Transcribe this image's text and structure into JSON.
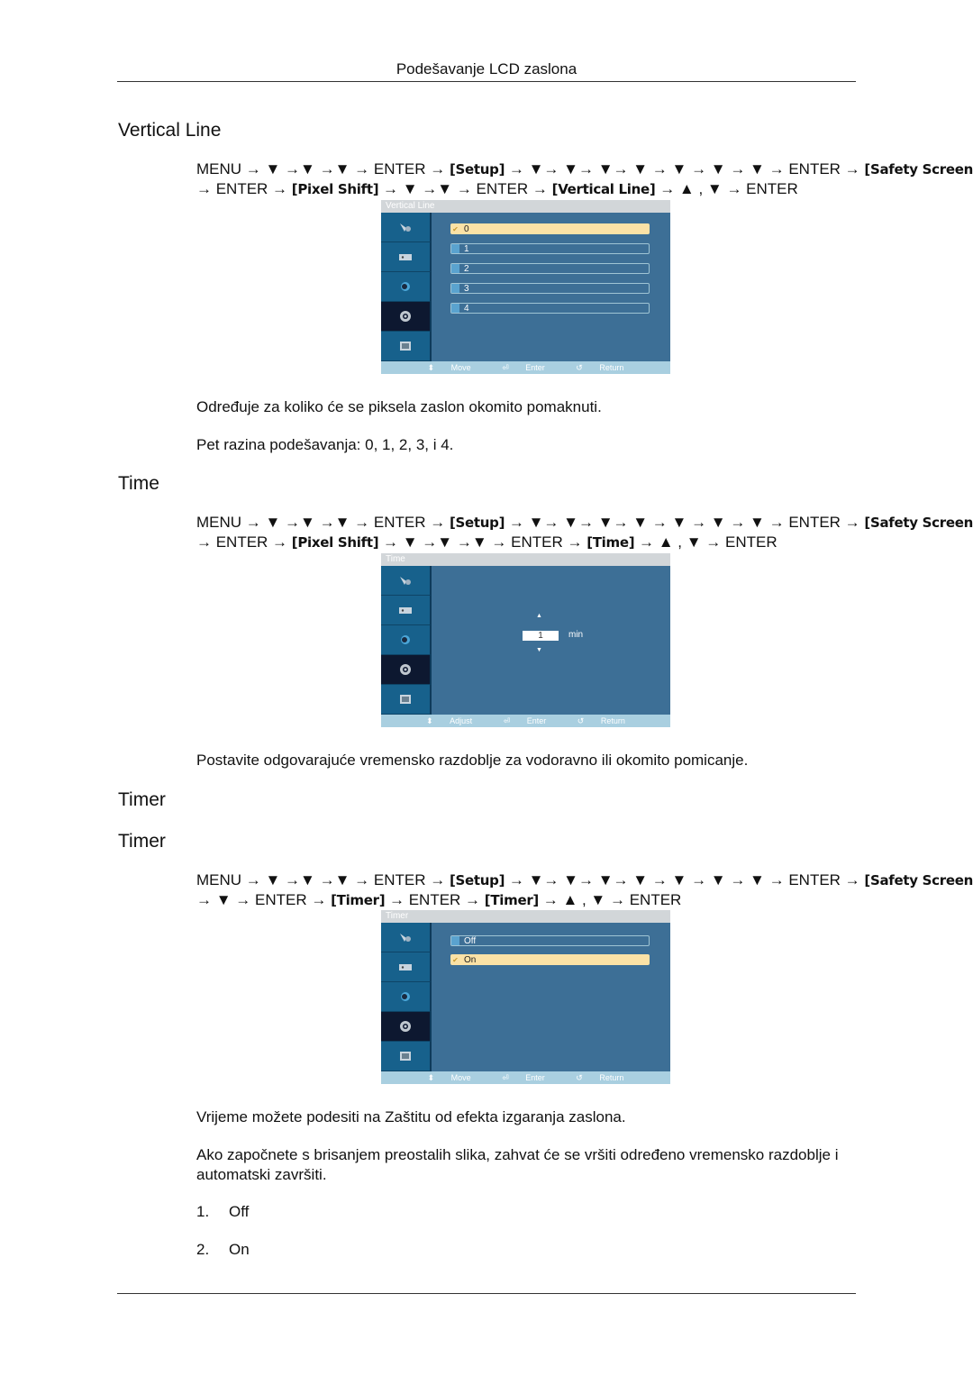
{
  "header": {
    "title": "Podešavanje LCD zaslona"
  },
  "sections": {
    "vertical_line": {
      "heading": "Vertical Line",
      "nav_line1": [
        "MENU",
        "→",
        "▼",
        "→",
        "▼",
        "→",
        "▼",
        "→",
        "ENTER",
        "→"
      ],
      "nav_setup": "[Setup]",
      "nav_line1b": "→ ▼→ ▼→ ▼→ ▼ → ▼ → ▼ → ▼ → ENTER →",
      "nav_safety": "[Safety Screen]",
      "nav_line2a": "→ ENTER →",
      "nav_pixel": "[Pixel Shift]",
      "nav_line2b": "→ ▼ →▼ → ENTER →",
      "nav_target": "[Vertical Line]",
      "nav_line2c": "→ ▲ , ▼ → ENTER",
      "osd": {
        "title": "Vertical Line",
        "options": [
          "0",
          "1",
          "2",
          "3",
          "4"
        ],
        "selected": "0",
        "footer": [
          "Move",
          "Enter",
          "Return"
        ]
      },
      "description": "Određuje za koliko će se piksela zaslon okomito pomaknuti.",
      "levels": "Pet razina podešavanja: 0, 1, 2, 3, i 4."
    },
    "time": {
      "heading": "Time",
      "nav_line1_text": "MENU → ▼ →▼ →▼ → ENTER →",
      "nav_setup": "[Setup]",
      "nav_line1b": "→ ▼→ ▼→ ▼→ ▼ → ▼ → ▼ → ▼ → ENTER →",
      "nav_safety": "[Safety Screen]",
      "nav_line2a": "→ ENTER →",
      "nav_pixel": "[Pixel Shift]",
      "nav_line2b": "→ ▼ →▼ →▼ → ENTER →",
      "nav_target": "[Time]",
      "nav_line2c": "→ ▲ , ▼ → ENTER",
      "osd": {
        "title": "Time",
        "value": "1",
        "unit": "min",
        "footer": [
          "Adjust",
          "Enter",
          "Return"
        ]
      },
      "description": "Postavite odgovarajuće vremensko razdoblje za vodoravno ili okomito pomicanje."
    },
    "timer": {
      "heading1": "Timer",
      "heading2": "Timer",
      "nav_line1_text": "MENU → ▼ →▼ →▼ → ENTER →",
      "nav_setup": "[Setup]",
      "nav_line1b": "→ ▼→ ▼→ ▼→ ▼ → ▼ → ▼ → ▼ → ENTER →",
      "nav_safety": "[Safety Screen]",
      "nav_line2a": "→ ▼ → ENTER →",
      "nav_timer1": "[Timer]",
      "nav_line2b": "→ ENTER →",
      "nav_timer2": "[Timer]",
      "nav_line2c": "→ ▲ , ▼ → ENTER",
      "osd": {
        "title": "Timer",
        "options": [
          "Off",
          "On"
        ],
        "selected": "On",
        "footer": [
          "Move",
          "Enter",
          "Return"
        ]
      },
      "description1": "Vrijeme možete podesiti na Zaštitu od efekta izgaranja zaslona.",
      "description2": "Ako započnete s brisanjem preostalih slika, zahvat će se vršiti određeno vremensko razdoblje i automatski završiti.",
      "list": [
        {
          "num": "1.",
          "label": "Off"
        },
        {
          "num": "2.",
          "label": "On"
        }
      ]
    }
  },
  "nav_common": {
    "line1_text": "MENU → ▼ →▼ →▼ → ENTER →"
  },
  "colors": {
    "osd_bg": "#3d6f96",
    "osd_side": "#17618c",
    "osd_active": "#0d1830",
    "osd_selected": "#fbe2a6",
    "osd_footer": "#a9cfe0"
  }
}
